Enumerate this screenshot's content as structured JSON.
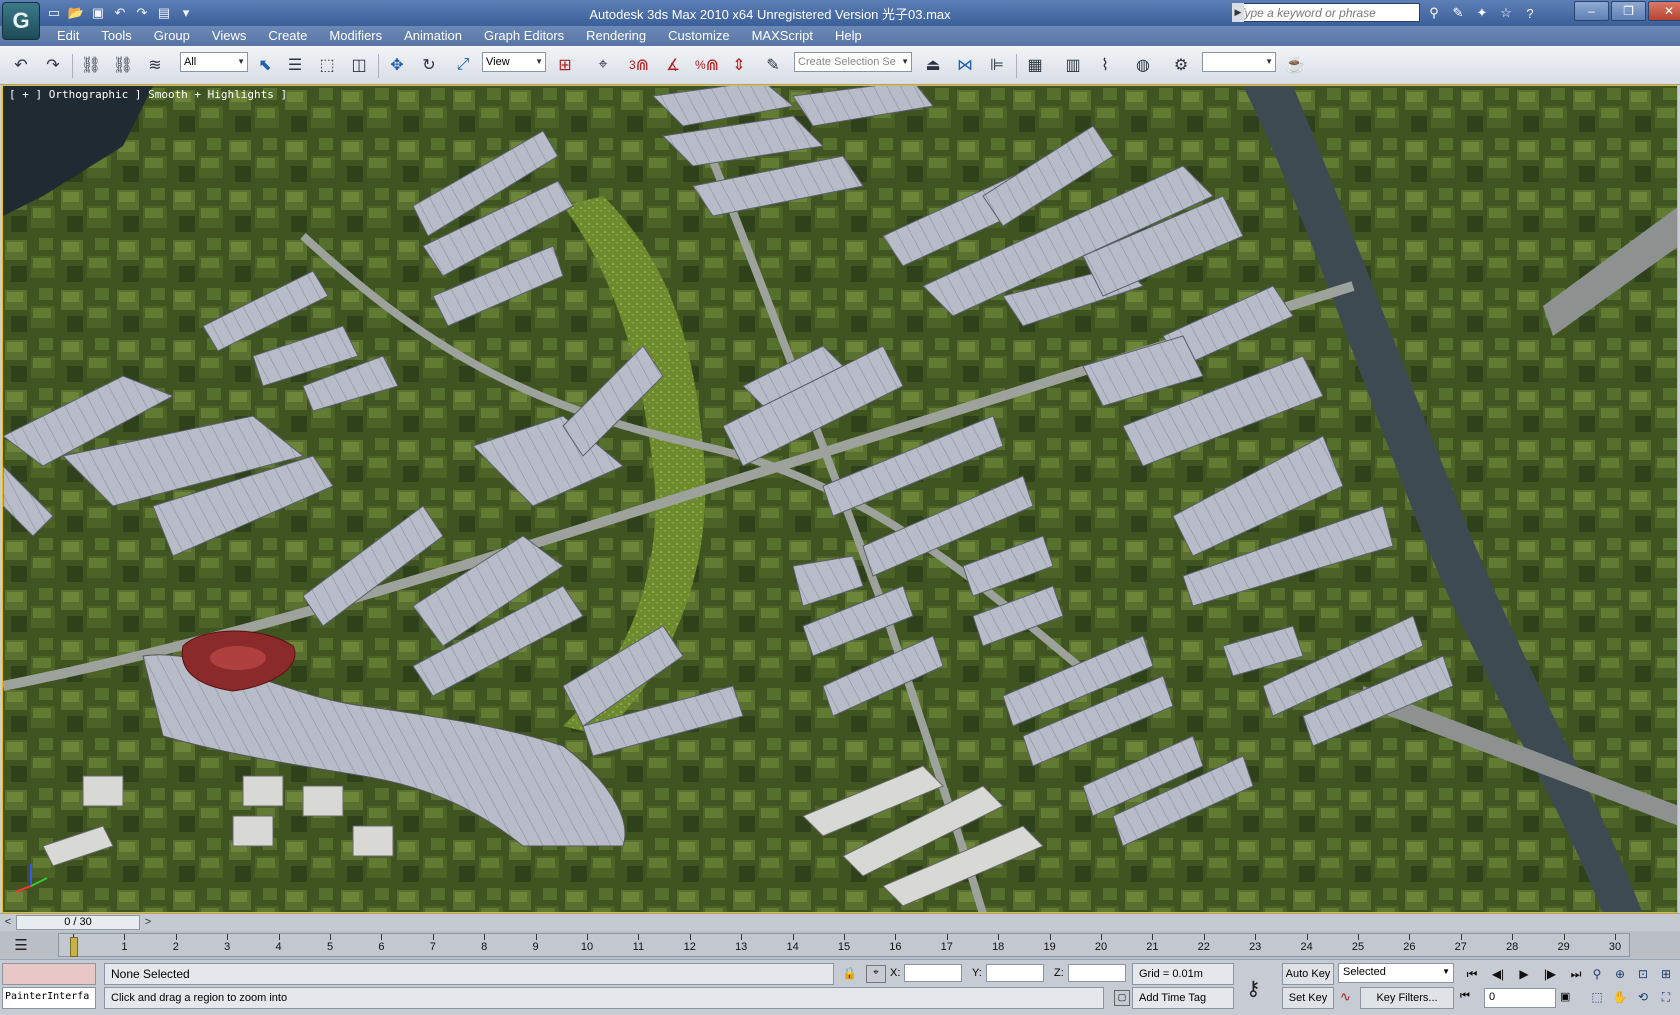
{
  "window": {
    "title": "Autodesk 3ds Max  2010 x64    Unregistered Version      光子03.max",
    "search_placeholder": "Type a keyword or phrase",
    "controls": [
      "–",
      "❐",
      "✕"
    ]
  },
  "app_logo": "G",
  "quick_access": [
    "new-icon",
    "open-icon",
    "save-icon",
    "undo-icon",
    "redo-icon",
    "project-folder-icon"
  ],
  "menu": [
    "Edit",
    "Tools",
    "Group",
    "Views",
    "Create",
    "Modifiers",
    "Animation",
    "Graph Editors",
    "Rendering",
    "Customize",
    "MAXScript",
    "Help"
  ],
  "toolbar": {
    "selection_filter": "All",
    "ref_coord": "View",
    "named_selection_placeholder": "Create Selection Se",
    "snap_label": "3",
    "spinner_snap": "%"
  },
  "viewport": {
    "label": "[ + ] Orthographic ] Smooth + Highlights ]",
    "border_color": "#f0c000"
  },
  "timeslider": {
    "position": "0 / 30",
    "left": "<",
    "right": ">"
  },
  "trackbar": {
    "ticks": [
      "0",
      "1",
      "2",
      "3",
      "4",
      "5",
      "6",
      "7",
      "8",
      "9",
      "10",
      "11",
      "12",
      "13",
      "14",
      "15",
      "16",
      "17",
      "18",
      "19",
      "20",
      "21",
      "22",
      "23",
      "24",
      "25",
      "26",
      "27",
      "28",
      "29",
      "30"
    ]
  },
  "status": {
    "listener": "PainterInterfa",
    "selection": "None Selected",
    "prompt": "Click and drag a region to zoom into",
    "x_label": "X:",
    "y_label": "Y:",
    "z_label": "Z:",
    "grid": "Grid = 0.01m",
    "add_time_tag": "Add Time Tag",
    "auto_key": "Auto Key",
    "set_key": "Set Key",
    "key_mode": "Selected",
    "key_filters": "Key Filters...",
    "frame": "0"
  }
}
